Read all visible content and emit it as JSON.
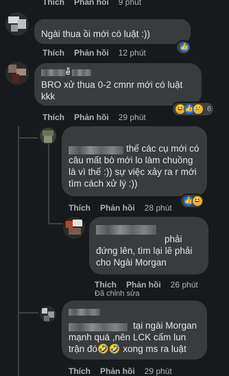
{
  "top_actions": {
    "like": "Thích",
    "reply": "Phản hồi",
    "time": "9 phút"
  },
  "comments": [
    {
      "text": "Ngài thua   ồi mới có luật :))",
      "like": "Thích",
      "reply": "Phản hồi",
      "time": "12 phút",
      "reactions": {
        "icons": [
          "like-icon"
        ],
        "count": ""
      }
    },
    {
      "name_visible": "ễ",
      "text": "BRO xử thua 0-2 cmnr mới có luật kkk",
      "like": "Thích",
      "reply": "Phản hồi",
      "time": "29 phút",
      "reactions": {
        "icons": [
          "haha-icon",
          "like-icon",
          "sad-icon"
        ],
        "count": "6"
      }
    },
    {
      "name_visible": "",
      "text": "thế các cụ mới có câu mất bò mới lo làm chuồng là vì thế :)) sự việc xảy ra r mới tìm cách xử lý :))",
      "like": "Thích",
      "reply": "Phản hồi",
      "time": "28 phút",
      "reactions": {
        "icons": [
          "like-icon",
          "haha-icon"
        ],
        "count": ""
      }
    },
    {
      "name_visible": "",
      "text": "phải đứng lên, tìm lại lẽ phải cho Ngài Morgan",
      "like": "Thích",
      "reply": "Phản hồi",
      "time": "26 phút",
      "edited": "Đã chỉnh sửa"
    },
    {
      "name_visible": "",
      "text": "tại ngài Morgan mạnh quá ,nên LCK cấm lun trận đó🤣🤣 xong ms ra luật",
      "like": "Thích",
      "reply": "Phản hồi",
      "time": "29 phút"
    }
  ],
  "colors": {
    "bg": "#18191a",
    "bubble": "#3a3b3c",
    "text": "#e4e6eb",
    "muted": "#b0b3b8",
    "like": "#1877f2"
  }
}
